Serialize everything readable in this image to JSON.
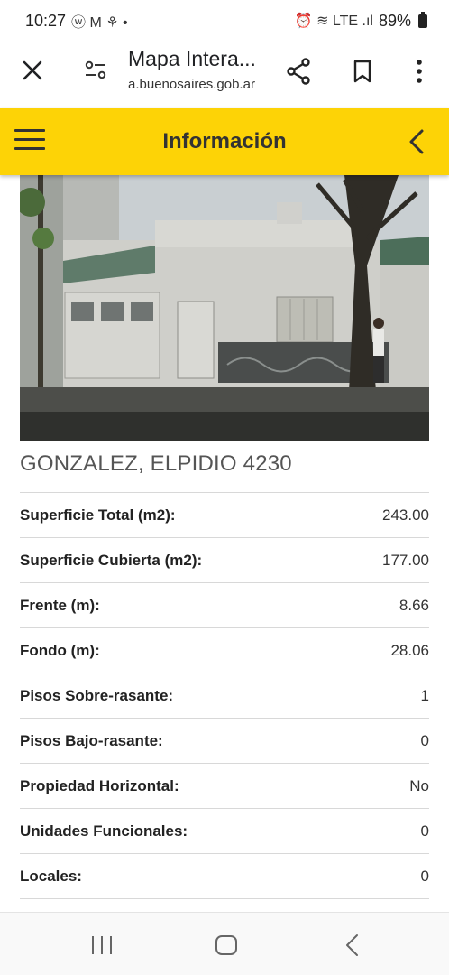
{
  "status_bar": {
    "time": "10:27",
    "left_glyphs": "ⓦ M ⚘ •",
    "right_glyphs": "⏰ ≋ LTE .ıl",
    "battery": "89%"
  },
  "browser": {
    "title": "Mapa Intera...",
    "domain": "a.buenosaires.gob.ar"
  },
  "header": {
    "title": "Información"
  },
  "property": {
    "photo_icon": "building-photo",
    "address": "GONZALEZ, ELPIDIO 4230",
    "rows": [
      {
        "label": "Superficie Total (m2):",
        "value": "243.00"
      },
      {
        "label": "Superficie Cubierta (m2):",
        "value": "177.00"
      },
      {
        "label": "Frente (m):",
        "value": "8.66"
      },
      {
        "label": "Fondo (m):",
        "value": "28.06"
      },
      {
        "label": "Pisos Sobre-rasante:",
        "value": "1"
      },
      {
        "label": "Pisos Bajo-rasante:",
        "value": "0"
      },
      {
        "label": "Propiedad Horizontal:",
        "value": "No"
      },
      {
        "label": "Unidades Funcionales:",
        "value": "0"
      },
      {
        "label": "Locales:",
        "value": "0"
      }
    ]
  },
  "colors": {
    "header_bg": "#fdd306",
    "header_text": "#333333"
  }
}
